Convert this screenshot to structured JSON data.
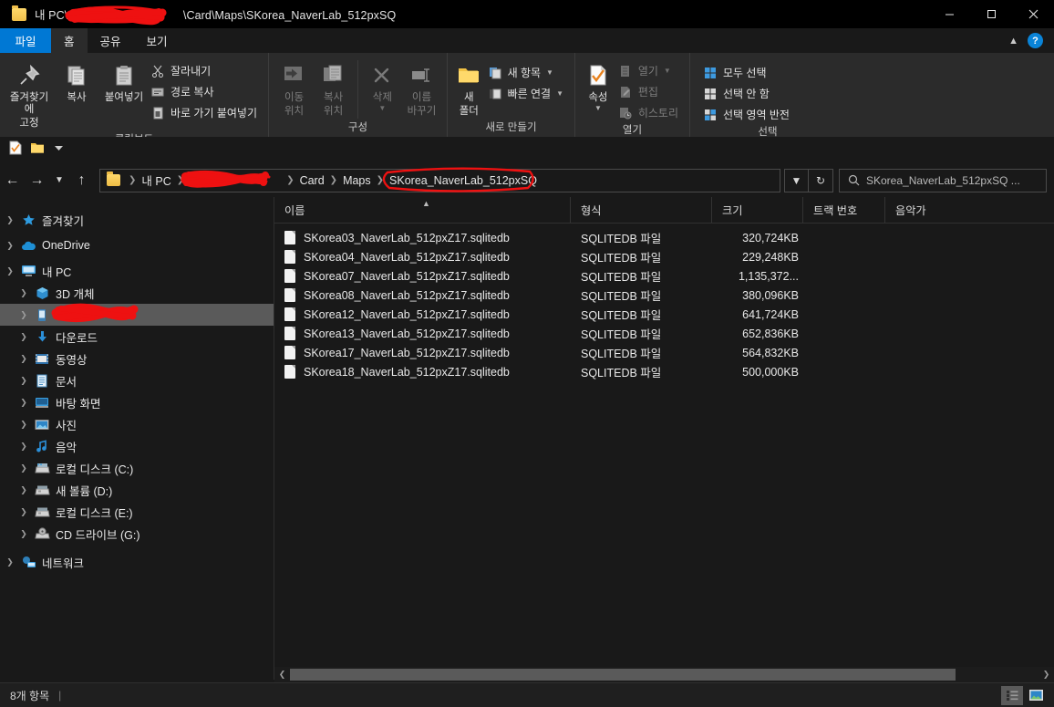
{
  "window": {
    "title_prefix": "내 PC\\",
    "title_suffix": "\\Card\\Maps\\SKorea_NaverLab_512pxSQ",
    "minimize_label": "최소화",
    "maximize_label": "최대화",
    "close_label": "닫기"
  },
  "tabs": [
    {
      "label": "파일",
      "active": false,
      "file": true
    },
    {
      "label": "홈",
      "active": true,
      "file": false
    },
    {
      "label": "공유",
      "active": false,
      "file": false
    },
    {
      "label": "보기",
      "active": false,
      "file": false
    }
  ],
  "ribbon": {
    "collapse_label": "리본 메뉴 축소",
    "help_label": "?",
    "groups": [
      {
        "title": "클립보드",
        "big": [
          {
            "label_line1": "즐겨찾기에",
            "label_line2": "고정",
            "icon": "pin-icon"
          },
          {
            "label_line1": "복사",
            "label_line2": "",
            "icon": "copy-icon"
          },
          {
            "label_line1": "붙여넣기",
            "label_line2": "",
            "icon": "paste-icon"
          }
        ],
        "small": [
          {
            "label": "잘라내기",
            "icon": "scissors-icon",
            "dim": false
          },
          {
            "label": "경로 복사",
            "icon": "copy-path-icon",
            "dim": false
          },
          {
            "label": "바로 가기 붙여넣기",
            "icon": "paste-shortcut-icon",
            "dim": false
          }
        ]
      },
      {
        "title": "구성",
        "big": [
          {
            "label_line1": "이동",
            "label_line2": "위치",
            "icon": "move-to-icon",
            "dropdown": true
          },
          {
            "label_line1": "복사",
            "label_line2": "위치",
            "icon": "copy-to-icon",
            "dropdown": true
          },
          {
            "label_line1": "삭제",
            "label_line2": "",
            "icon": "delete-icon",
            "dropdown": true,
            "dim": true
          },
          {
            "label_line1": "이름",
            "label_line2": "바꾸기",
            "icon": "rename-icon",
            "dim": true
          }
        ],
        "small": []
      },
      {
        "title": "새로 만들기",
        "big": [
          {
            "label_line1": "새",
            "label_line2": "폴더",
            "icon": "new-folder-icon"
          }
        ],
        "small": [
          {
            "label": "새 항목",
            "icon": "new-item-icon",
            "dropdown": true
          },
          {
            "label": "빠른 연결",
            "icon": "easy-access-icon",
            "dropdown": true
          }
        ]
      },
      {
        "title": "열기",
        "big": [
          {
            "label_line1": "속성",
            "label_line2": "",
            "icon": "properties-icon",
            "dropdown": true
          }
        ],
        "small": [
          {
            "label": "열기",
            "icon": "open-icon",
            "dim": true,
            "dropdown": true
          },
          {
            "label": "편집",
            "icon": "edit-icon",
            "dim": true
          },
          {
            "label": "히스토리",
            "icon": "history-icon",
            "dim": true
          }
        ]
      },
      {
        "title": "선택",
        "big": [],
        "small": [
          {
            "label": "모두 선택",
            "icon": "select-all-icon"
          },
          {
            "label": "선택 안 함",
            "icon": "select-none-icon"
          },
          {
            "label": "선택 영역 반전",
            "icon": "invert-selection-icon"
          }
        ]
      }
    ]
  },
  "quick_access": [
    {
      "name": "properties-icon"
    },
    {
      "name": "new-folder-icon"
    },
    {
      "name": "customize-chevron-icon"
    }
  ],
  "address": {
    "back_label": "뒤로",
    "forward_label": "앞으로",
    "recent_label": "최근 위치",
    "up_label": "위로",
    "refresh_label": "새로 고침",
    "crumbs": [
      {
        "label": "내 PC",
        "redacted": false
      },
      {
        "label": "",
        "redacted": true
      },
      {
        "label": "Card",
        "redacted": false
      },
      {
        "label": "Maps",
        "redacted": false
      },
      {
        "label": "SKorea_NaverLab_512pxSQ",
        "redacted": false,
        "circled": true
      }
    ]
  },
  "search": {
    "placeholder": "SKorea_NaverLab_512pxSQ ...",
    "icon": "search-icon"
  },
  "nav_tree": [
    {
      "label": "즐겨찾기",
      "icon": "star-icon",
      "level": 1,
      "expanded": false,
      "selected": false,
      "redacted": false
    },
    {
      "label": "OneDrive",
      "icon": "cloud-icon",
      "level": 1,
      "expanded": false,
      "selected": false,
      "redacted": false
    },
    {
      "label": "내 PC",
      "icon": "this-pc-icon",
      "level": 1,
      "expanded": true,
      "selected": false,
      "redacted": false
    },
    {
      "label": "3D 개체",
      "icon": "3d-objects-icon",
      "level": 2,
      "expanded": false,
      "selected": false,
      "redacted": false
    },
    {
      "label": "",
      "icon": "device-icon",
      "level": 2,
      "expanded": false,
      "selected": true,
      "redacted": true
    },
    {
      "label": "다운로드",
      "icon": "downloads-icon",
      "level": 2,
      "expanded": false,
      "selected": false,
      "redacted": false
    },
    {
      "label": "동영상",
      "icon": "videos-icon",
      "level": 2,
      "expanded": false,
      "selected": false,
      "redacted": false
    },
    {
      "label": "문서",
      "icon": "documents-icon",
      "level": 2,
      "expanded": false,
      "selected": false,
      "redacted": false
    },
    {
      "label": "바탕 화면",
      "icon": "desktop-icon",
      "level": 2,
      "expanded": false,
      "selected": false,
      "redacted": false
    },
    {
      "label": "사진",
      "icon": "pictures-icon",
      "level": 2,
      "expanded": false,
      "selected": false,
      "redacted": false
    },
    {
      "label": "음악",
      "icon": "music-icon",
      "level": 2,
      "expanded": false,
      "selected": false,
      "redacted": false
    },
    {
      "label": "로컬 디스크 (C:)",
      "icon": "drive-icon",
      "level": 2,
      "expanded": false,
      "selected": false,
      "redacted": false
    },
    {
      "label": "새 볼륨 (D:)",
      "icon": "drive-icon",
      "level": 2,
      "expanded": false,
      "selected": false,
      "redacted": false
    },
    {
      "label": "로컬 디스크 (E:)",
      "icon": "drive-icon",
      "level": 2,
      "expanded": false,
      "selected": false,
      "redacted": false
    },
    {
      "label": "CD 드라이브 (G:)",
      "icon": "cd-drive-icon",
      "level": 2,
      "expanded": false,
      "selected": false,
      "redacted": false
    },
    {
      "label": "네트워크",
      "icon": "network-icon",
      "level": 1,
      "expanded": false,
      "selected": false,
      "redacted": false
    }
  ],
  "file_list": {
    "columns": [
      {
        "label": "이름",
        "sorted": "asc"
      },
      {
        "label": "형식",
        "sorted": ""
      },
      {
        "label": "크기",
        "sorted": ""
      },
      {
        "label": "트랙 번호",
        "sorted": ""
      },
      {
        "label": "음악가",
        "sorted": ""
      }
    ],
    "rows": [
      {
        "name": "SKorea03_NaverLab_512pxZ17.sqlitedb",
        "type": "SQLITEDB 파일",
        "size": "320,724KB",
        "track": "",
        "artist": ""
      },
      {
        "name": "SKorea04_NaverLab_512pxZ17.sqlitedb",
        "type": "SQLITEDB 파일",
        "size": "229,248KB",
        "track": "",
        "artist": ""
      },
      {
        "name": "SKorea07_NaverLab_512pxZ17.sqlitedb",
        "type": "SQLITEDB 파일",
        "size": "1,135,372...",
        "track": "",
        "artist": ""
      },
      {
        "name": "SKorea08_NaverLab_512pxZ17.sqlitedb",
        "type": "SQLITEDB 파일",
        "size": "380,096KB",
        "track": "",
        "artist": ""
      },
      {
        "name": "SKorea12_NaverLab_512pxZ17.sqlitedb",
        "type": "SQLITEDB 파일",
        "size": "641,724KB",
        "track": "",
        "artist": ""
      },
      {
        "name": "SKorea13_NaverLab_512pxZ17.sqlitedb",
        "type": "SQLITEDB 파일",
        "size": "652,836KB",
        "track": "",
        "artist": ""
      },
      {
        "name": "SKorea17_NaverLab_512pxZ17.sqlitedb",
        "type": "SQLITEDB 파일",
        "size": "564,832KB",
        "track": "",
        "artist": ""
      },
      {
        "name": "SKorea18_NaverLab_512pxZ17.sqlitedb",
        "type": "SQLITEDB 파일",
        "size": "500,000KB",
        "track": "",
        "artist": ""
      }
    ]
  },
  "status": {
    "item_count": "8개 항목",
    "separator": "|",
    "views": [
      {
        "name": "details-view-button",
        "active": true
      },
      {
        "name": "large-icons-view-button",
        "active": false
      }
    ]
  },
  "colors": {
    "accent": "#0078d4",
    "window_bg": "#191919",
    "ribbon_bg": "#2b2b2b",
    "selection": "#5a5a5a",
    "annotation_red": "#ee1111",
    "folder_yellow": "#ffd96b"
  }
}
